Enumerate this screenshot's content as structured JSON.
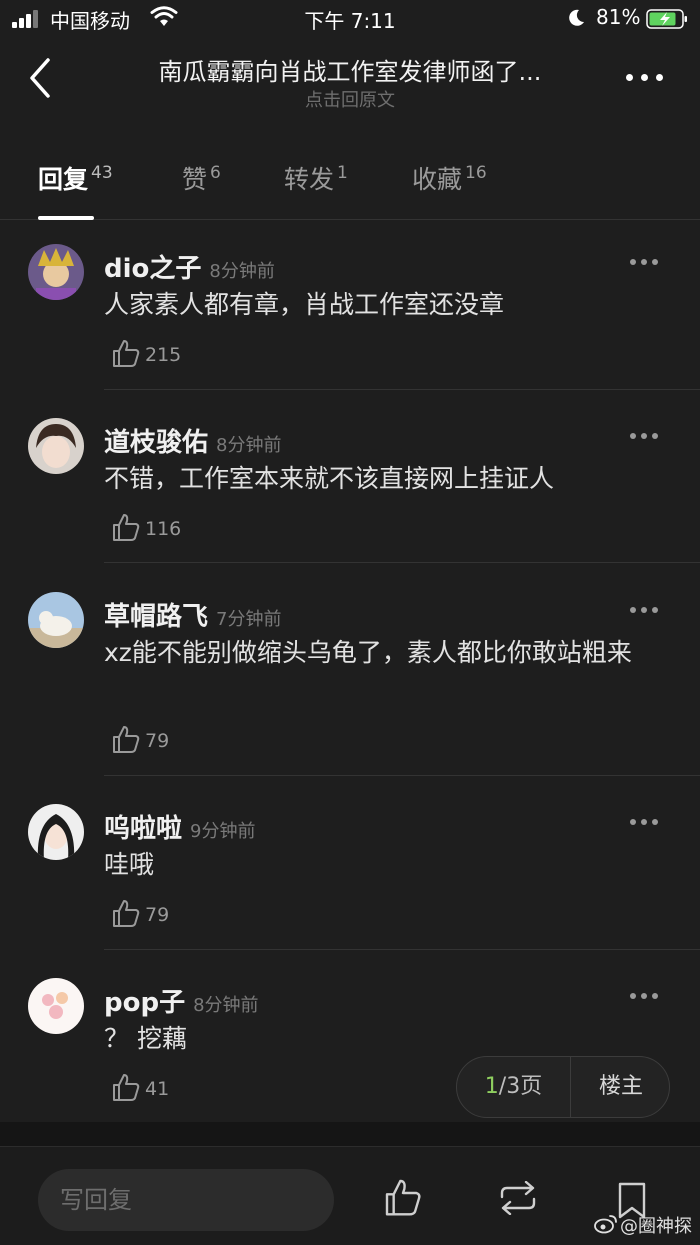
{
  "status_bar": {
    "carrier": "中国移动",
    "time": "下午 7:11",
    "battery": "81%"
  },
  "nav": {
    "title": "南瓜霸霸向肖战工作室发律师函了...",
    "subtitle": "点击回原文"
  },
  "tabs": [
    {
      "label": "回复",
      "count": "43"
    },
    {
      "label": "赞",
      "count": "6"
    },
    {
      "label": "转发",
      "count": "1"
    },
    {
      "label": "收藏",
      "count": "16"
    }
  ],
  "comments": [
    {
      "user": "dio之子",
      "time": "8分钟前",
      "text": "人家素人都有章，肖战工作室还没章",
      "likes": "215"
    },
    {
      "user": "道枝骏佑",
      "time": "8分钟前",
      "text": "不错，工作室本来就不该直接网上挂证人",
      "likes": "116"
    },
    {
      "user": "草帽路飞",
      "time": "7分钟前",
      "text": "xz能不能别做缩头乌龟了，素人都比你敢站粗来",
      "likes": "79"
    },
    {
      "user": "呜啦啦",
      "time": "9分钟前",
      "text": "哇哦",
      "likes": "79"
    },
    {
      "user": "pop子",
      "time": "8分钟前",
      "text": "？ 挖藕",
      "likes": "41"
    }
  ],
  "pager": {
    "current": "1",
    "total": "/3",
    "unit": "页",
    "host_label": "楼主"
  },
  "bottom": {
    "reply_placeholder": "写回复"
  },
  "watermark": "@圈神探",
  "colors": {
    "background": "#1e1e1e",
    "accent_page": "#8fcf5f",
    "text": "#e6e6e6",
    "muted": "#7a7a7a"
  }
}
